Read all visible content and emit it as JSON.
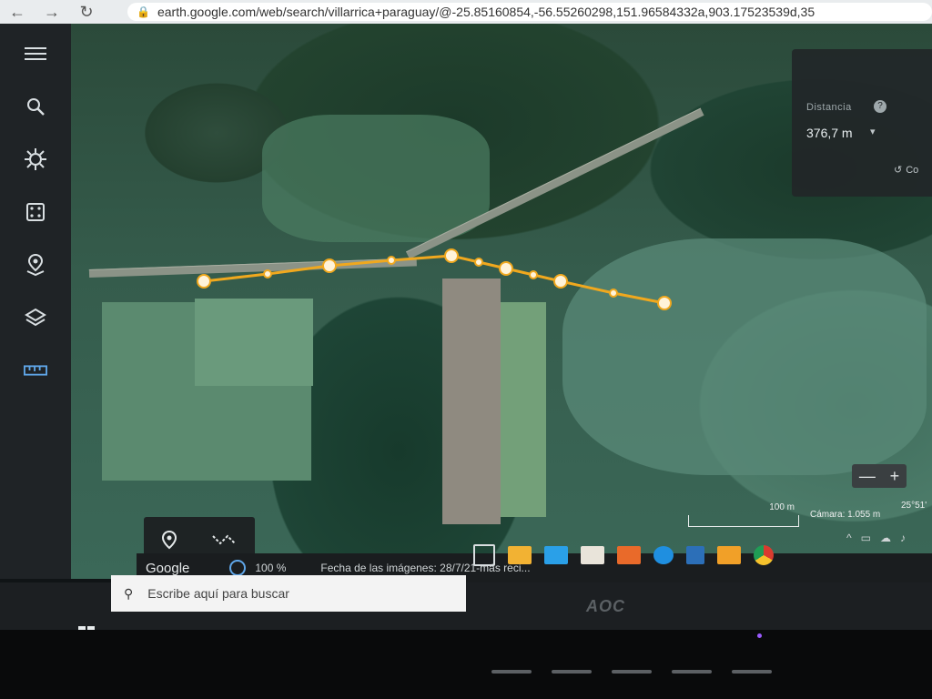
{
  "browser": {
    "url": "earth.google.com/web/search/villarrica+paraguay/@-25.85160854,-56.55260298,151.96584332a,903.17523539d,35"
  },
  "measure_panel": {
    "title": "Distancia",
    "help_glyph": "?",
    "value": "376,7 m",
    "reset_label": "Co"
  },
  "map": {
    "scale": "100 m",
    "camera": "Cámara: 1.055 m",
    "coords": "25°51'",
    "zoom_minus": "—",
    "zoom_plus": "+"
  },
  "status_bar": {
    "google": "Google",
    "zoom_percent": "100 %",
    "imagery_date": "Fecha de las imágenes: 28/7/21-más reci..."
  },
  "taskbar": {
    "search_placeholder": "Escribe aquí para buscar",
    "apps": [
      "task-view",
      "file-explorer",
      "mail",
      "store",
      "media",
      "edge",
      "calculator",
      "folder-app",
      "chrome"
    ]
  },
  "monitor": {
    "brand": "AOC"
  },
  "colors": {
    "measure_line": "#f0a81e",
    "accent": "#5fa6e8"
  }
}
